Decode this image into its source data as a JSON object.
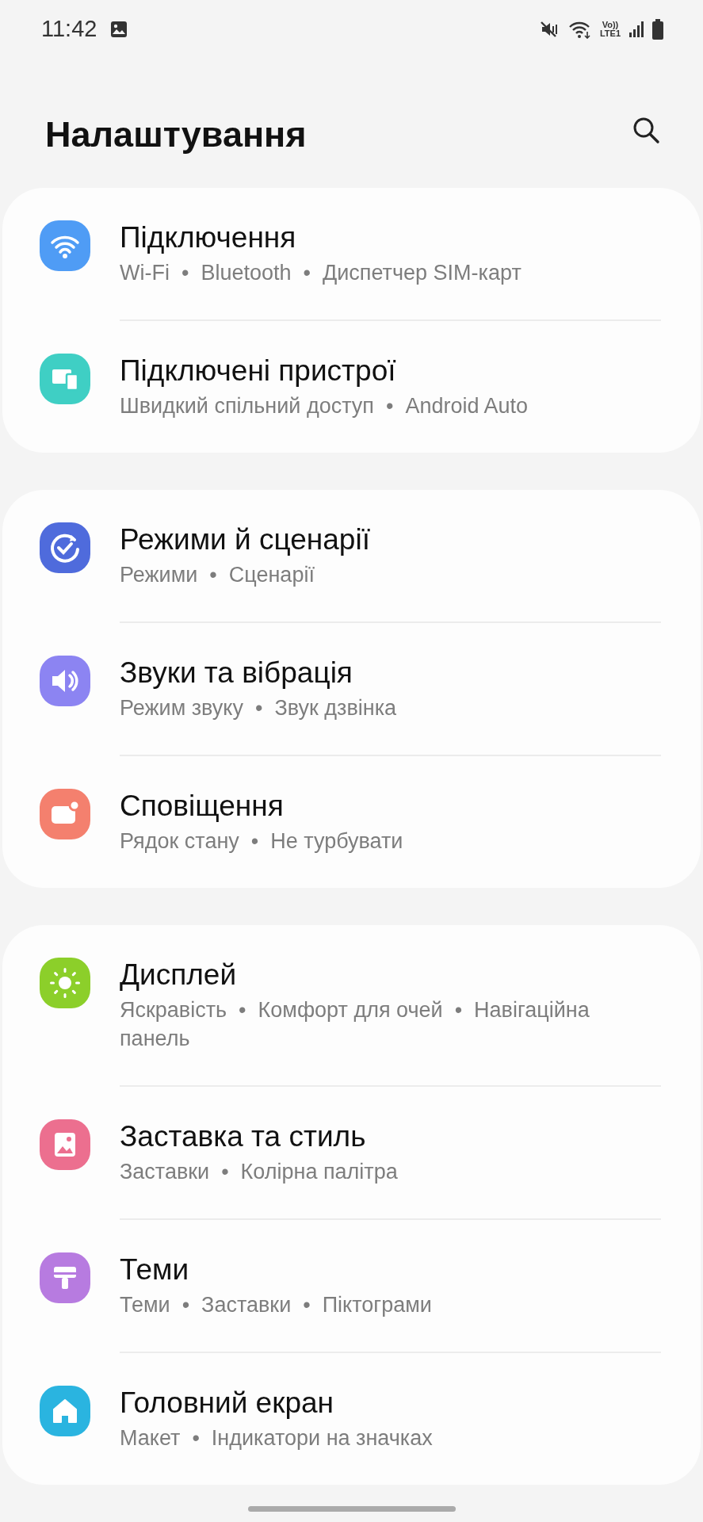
{
  "status_bar": {
    "time": "11:42",
    "network_label": [
      "Vo))",
      "LTE1"
    ]
  },
  "header": {
    "title": "Налаштування"
  },
  "groups": [
    {
      "items": [
        {
          "kind": "wifi",
          "color": "#4f9cf5",
          "title": "Підключення",
          "subtitle": "Wi-Fi  •  Bluetooth  •  Диспетчер SIM-карт"
        },
        {
          "kind": "devices",
          "color": "#3fcfc4",
          "title": "Підключені пристрої",
          "subtitle": "Швидкий спільний доступ  •  Android Auto"
        }
      ]
    },
    {
      "items": [
        {
          "kind": "modes",
          "color": "#4f6bdc",
          "title": "Режими й сценарії",
          "subtitle": "Режими  •  Сценарії"
        },
        {
          "kind": "sound",
          "color": "#8c84f2",
          "title": "Звуки та вібрація",
          "subtitle": "Режим звуку  •  Звук дзвінка"
        },
        {
          "kind": "notifications",
          "color": "#f4806e",
          "title": "Сповіщення",
          "subtitle": "Рядок стану  •  Не турбувати"
        }
      ]
    },
    {
      "items": [
        {
          "kind": "display",
          "color": "#8ccf2a",
          "title": "Дисплей",
          "subtitle": "Яскравість  •  Комфорт для очей  •  Навігаційна панель"
        },
        {
          "kind": "wallpaper",
          "color": "#ec6f8f",
          "title": "Заставка та стиль",
          "subtitle": "Заставки  •  Колірна палітра"
        },
        {
          "kind": "themes",
          "color": "#b77be0",
          "title": "Теми",
          "subtitle": "Теми  •  Заставки  •  Піктограми"
        },
        {
          "kind": "home",
          "color": "#2ab4e0",
          "title": "Головний екран",
          "subtitle": "Макет  •  Індикатори на значках"
        }
      ]
    }
  ]
}
